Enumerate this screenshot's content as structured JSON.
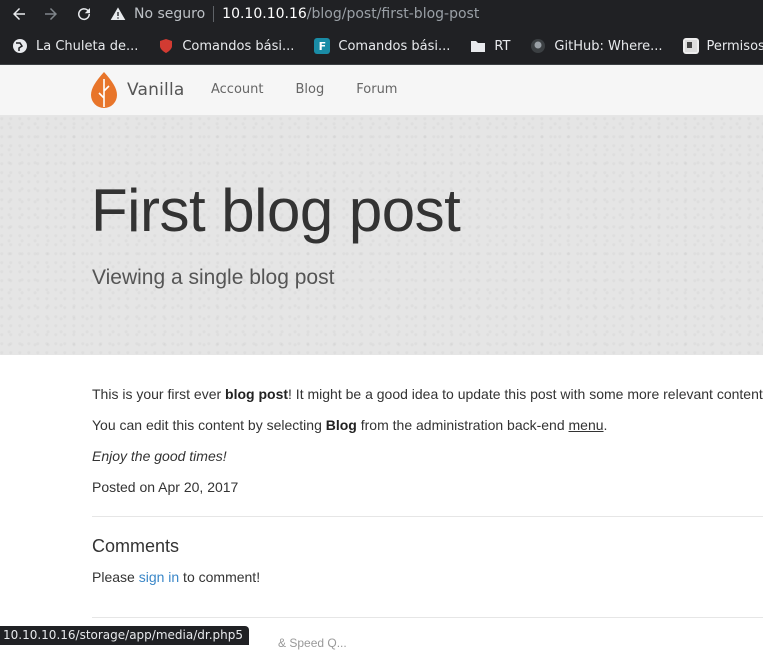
{
  "browser": {
    "insecure_label": "No seguro",
    "url_host": "10.10.10.16",
    "url_path": "/blog/post/first-blog-post",
    "status_url": "10.10.10.16/storage/app/media/dr.php5"
  },
  "bookmarks": [
    {
      "label": "La Chuleta de...",
      "icon": "globe-icon"
    },
    {
      "label": "Comandos bási...",
      "icon": "shield-icon"
    },
    {
      "label": "Comandos bási...",
      "icon": "f-icon"
    },
    {
      "label": "RT",
      "icon": "folder-icon"
    },
    {
      "label": "GitHub: Where...",
      "icon": "github-icon"
    },
    {
      "label": "Permisos ba",
      "icon": "page-icon"
    }
  ],
  "site": {
    "brand": "Vanilla",
    "menu": [
      "Account",
      "Blog",
      "Forum"
    ]
  },
  "hero": {
    "title": "First blog post",
    "subtitle": "Viewing a single blog post"
  },
  "post": {
    "p1_a": "This is your first ever ",
    "p1_b": "blog post",
    "p1_c": "! It might be a good idea to update this post with some more relevant content.",
    "p2_a": "You can edit this content by selecting ",
    "p2_b": "Blog",
    "p2_c": " from the administration back-end ",
    "p2_link": "menu",
    "p2_d": ".",
    "p3": "Enjoy the good times!",
    "posted": "Posted on Apr 20, 2017"
  },
  "comments": {
    "title": "Comments",
    "text_a": "Please ",
    "link": "sign in",
    "text_b": " to comment!"
  },
  "footer_partial": "& Speed Q..."
}
